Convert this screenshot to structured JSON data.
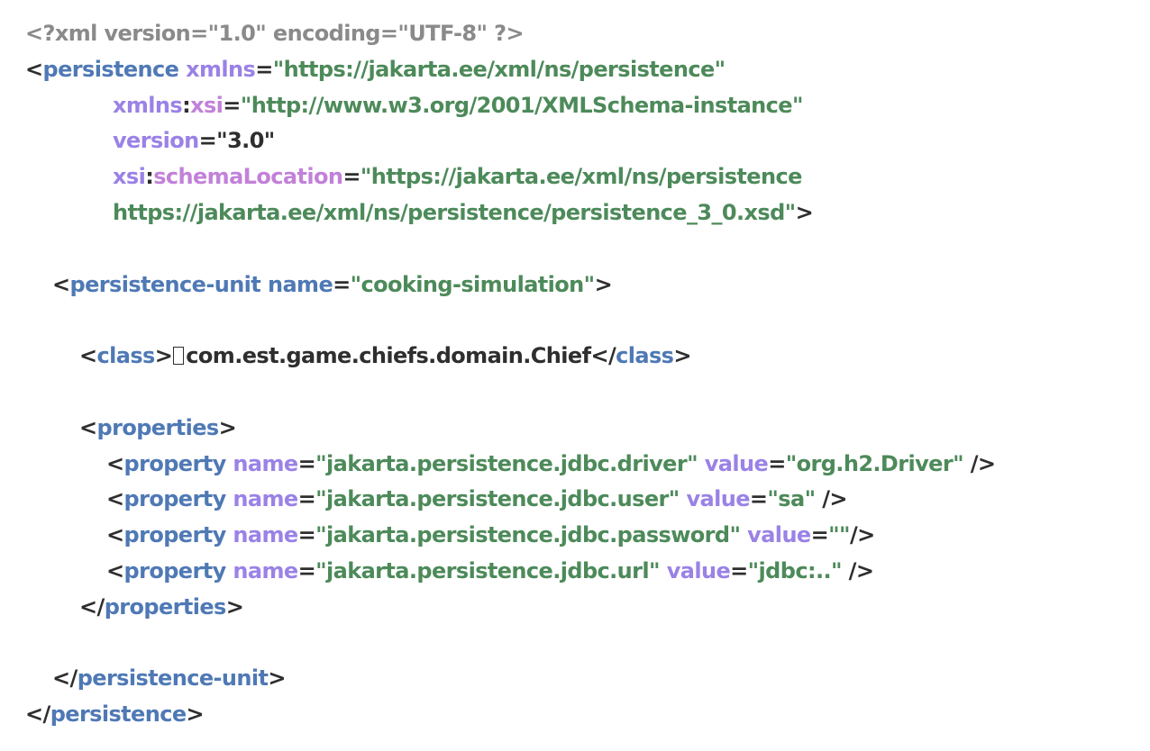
{
  "xml_decl": "<?xml version=\"1.0\" encoding=\"UTF-8\" ?>",
  "persistence": {
    "tag": "persistence",
    "xmlns_attr": "xmlns",
    "xmlns_value": "\"https://jakarta.ee/xml/ns/persistence\"",
    "xmlns_xsi_prefix": "xmlns",
    "xmlns_xsi_local": "xsi",
    "xmlns_xsi_value": "\"http://www.w3.org/2001/XMLSchema-instance\"",
    "version_attr": "version",
    "version_value": "\"3.0\"",
    "schema_prefix": "xsi",
    "schema_local": "schemaLocation",
    "schema_value_1": "\"https://jakarta.ee/xml/ns/persistence",
    "schema_value_2": "https://jakarta.ee/xml/ns/persistence/persistence_3_0.xsd\""
  },
  "persistence_unit": {
    "tag": "persistence-unit",
    "name_attr": "name",
    "name_value": "\"cooking-simulation\""
  },
  "class_element": {
    "tag": "class",
    "text": "com.est.game.chiefs.domain.Chief"
  },
  "properties": {
    "tag": "properties",
    "items": [
      {
        "tag": "property",
        "name_attr": "name",
        "name_value": "\"jakarta.persistence.jdbc.driver\"",
        "value_attr": "value",
        "value_value": "\"org.h2.Driver\"",
        "close": " />"
      },
      {
        "tag": "property",
        "name_attr": "name",
        "name_value": "\"jakarta.persistence.jdbc.user\"",
        "value_attr": "value",
        "value_value": "\"sa\"",
        "close": " />"
      },
      {
        "tag": "property",
        "name_attr": "name",
        "name_value": "\"jakarta.persistence.jdbc.password\"",
        "value_attr": "value",
        "value_value": "\"\"",
        "close": "/>"
      },
      {
        "tag": "property",
        "name_attr": "name",
        "name_value": "\"jakarta.persistence.jdbc.url\"",
        "value_attr": "value",
        "value_value": "\"jdbc:..\"",
        "close": " />"
      }
    ]
  },
  "colors": {
    "tag": "#4f79b5",
    "attribute": "#9a82e6",
    "namespace_local": "#c281d9",
    "string": "#4d8a5a",
    "text": "#2e2e2e",
    "declaration": "#8a8a8a"
  }
}
